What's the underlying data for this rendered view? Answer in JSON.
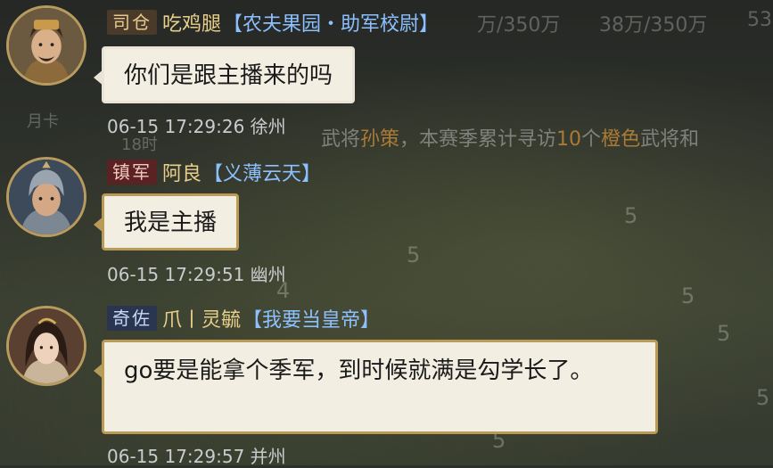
{
  "background": {
    "top_stats": [
      "万/350万",
      "38万/350万",
      "53"
    ],
    "side_labels": [
      "月卡",
      "18时"
    ],
    "map_numbers": [
      "5",
      "5",
      "5",
      "4",
      "5",
      "5",
      "5"
    ],
    "announcement": {
      "prefix": "武将",
      "hero": "孙策",
      "middle": "，本赛季累计寻访",
      "count": "10",
      "mid2": "个",
      "quality": "橙色",
      "suffix": "武将和"
    }
  },
  "messages": [
    {
      "rank": "司仓",
      "name": "吃鸡腿",
      "group": "【农夫果园・助军校尉】",
      "text": "你们是跟主播来的吗",
      "time": "06-15 17:29:26 徐州"
    },
    {
      "rank": "镇军",
      "name": "阿良",
      "group": "【义薄云天】",
      "text": "我是主播",
      "time": "06-15 17:29:51 幽州"
    },
    {
      "rank": "奇佐",
      "name": "爪丨灵毓",
      "group": "【我要当皇帝】",
      "text": "go要是能拿个季军，到时候就满是勾学长了。",
      "time": "06-15 17:29:57 并州"
    }
  ],
  "colors": {
    "bubble_bg": "#f3eee2",
    "bubble_border": "#b99a56",
    "name": "#e8cf8a",
    "group": "#8cc0ff",
    "timestamp": "#c9cccd"
  }
}
